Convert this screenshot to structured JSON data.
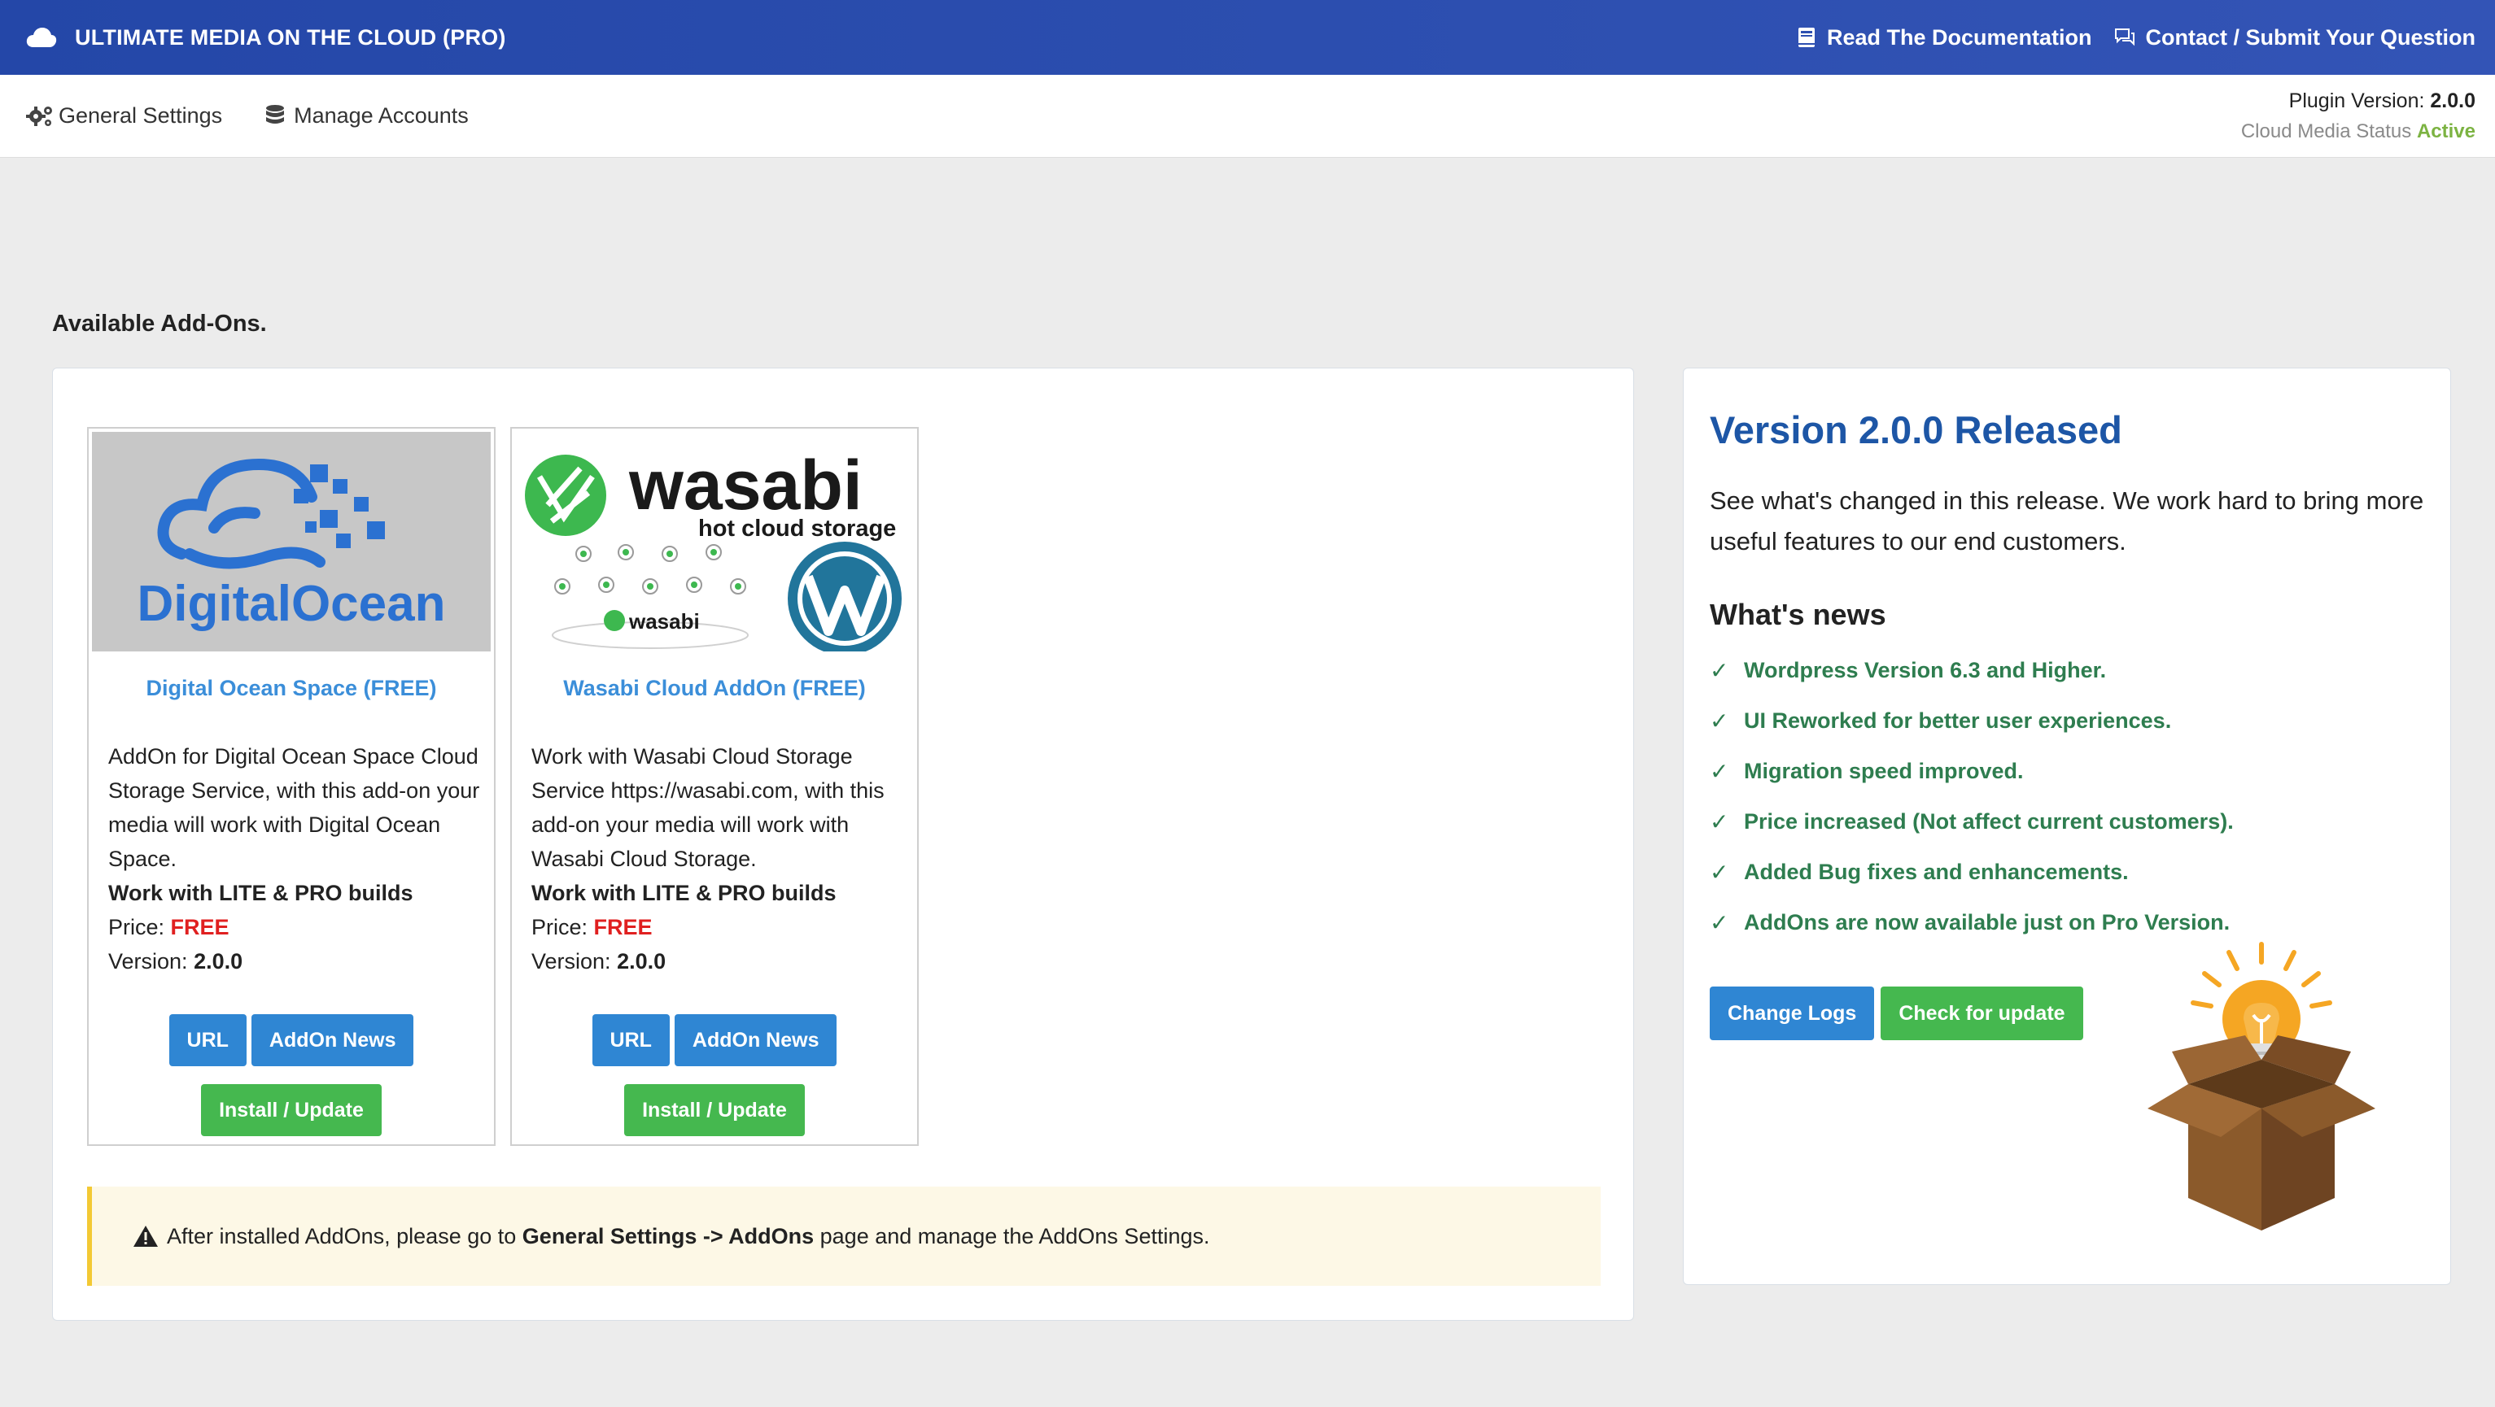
{
  "header": {
    "app_title": "ULTIMATE MEDIA ON THE CLOUD (PRO)",
    "links": [
      {
        "label": "Read The Documentation",
        "icon": "book-icon"
      },
      {
        "label": "Contact / Submit Your Question",
        "icon": "chat-icon"
      }
    ],
    "color": "#2447a8"
  },
  "subnav": {
    "tabs": [
      {
        "label": "General Settings",
        "icon": "gears-icon"
      },
      {
        "label": "Manage Accounts",
        "icon": "database-icon"
      }
    ],
    "plugin_version_label": "Plugin Version:",
    "plugin_version_value": "2.0.0",
    "status_label": "Cloud Media Status",
    "status_value": "Active",
    "status_color": "#7cb342"
  },
  "section_title": "Available Add-Ons.",
  "addons": [
    {
      "title": "Digital Ocean Space (FREE)",
      "logo_text": "DigitalOcean",
      "desc": "AddOn for Digital Ocean Space Cloud Storage Service, with this add-on your media will work with Digital Ocean Space.",
      "builds": "Work with LITE & PRO builds",
      "price_label": "Price:",
      "price_value": "FREE",
      "version_label": "Version:",
      "version_value": "2.0.0",
      "btn_url": "URL",
      "btn_news": "AddOn News",
      "btn_install": "Install / Update"
    },
    {
      "title": "Wasabi Cloud AddOn (FREE)",
      "logo_text": "wasabi",
      "logo_tagline": "hot cloud storage",
      "logo_small": "wasabi",
      "desc": "Work with Wasabi Cloud Storage Service https://wasabi.com, with this add-on your media will work with Wasabi Cloud Storage.",
      "builds": "Work with LITE & PRO builds",
      "price_label": "Price:",
      "price_value": "FREE",
      "version_label": "Version:",
      "version_value": "2.0.0",
      "btn_url": "URL",
      "btn_news": "AddOn News",
      "btn_install": "Install / Update"
    }
  ],
  "notice": {
    "before": "After installed AddOns, please go to",
    "path": "General Settings -> AddOns",
    "after": "page and manage the AddOns Settings."
  },
  "release": {
    "title": "Version 2.0.0 Released",
    "intro": "See what's changed in this release. We work hard to bring more useful features to our end customers.",
    "news_title": "What's news",
    "items": [
      "Wordpress Version 6.3 and Higher.",
      "UI Reworked for better user experiences.",
      "Migration speed improved.",
      "Price increased (Not affect current customers).",
      "Added Bug fixes and enhancements.",
      "AddOns are now available just on Pro Version."
    ],
    "check_glyph": "✓",
    "btn_changelogs": "Change Logs",
    "btn_check_update": "Check for update"
  }
}
